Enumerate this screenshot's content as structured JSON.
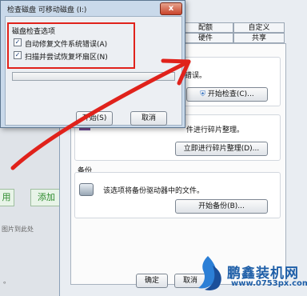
{
  "background_window": {
    "btn_use": "用",
    "btn_add": "添加",
    "hint_text": "图片到此处",
    "small_mark": "。"
  },
  "properties": {
    "tabs_row1": [
      "配额",
      "自定义"
    ],
    "tabs_row2": [
      "硬件",
      "共享"
    ],
    "check_text_tail": "错误。",
    "check_button": "开始检查(C)...",
    "defrag_text": "件进行碎片整理。",
    "defrag_button": "立即进行碎片整理(D)...",
    "backup_title": "备份",
    "backup_text": "该选项将备份驱动器中的文件。",
    "backup_button": "开始备份(B)...",
    "ok_button": "确定",
    "cancel_button": "取消"
  },
  "dialog": {
    "title": "检查磁盘 可移动磁盘 (I:)",
    "close_symbol": "x",
    "group_label": "磁盘检查选项",
    "options": [
      {
        "label": "自动修复文件系统错误(A)",
        "checked": true
      },
      {
        "label": "扫描并尝试恢复坏扇区(N)",
        "checked": true
      }
    ],
    "check_mark": "✓",
    "start_button": "开始(S)",
    "cancel_button": "取消"
  },
  "watermark": {
    "brand": "鹏鑫装机网",
    "url": "www.0753px.com"
  },
  "colors": {
    "highlight_red": "#e0221b",
    "watermark_blue": "#1f5fa8"
  }
}
